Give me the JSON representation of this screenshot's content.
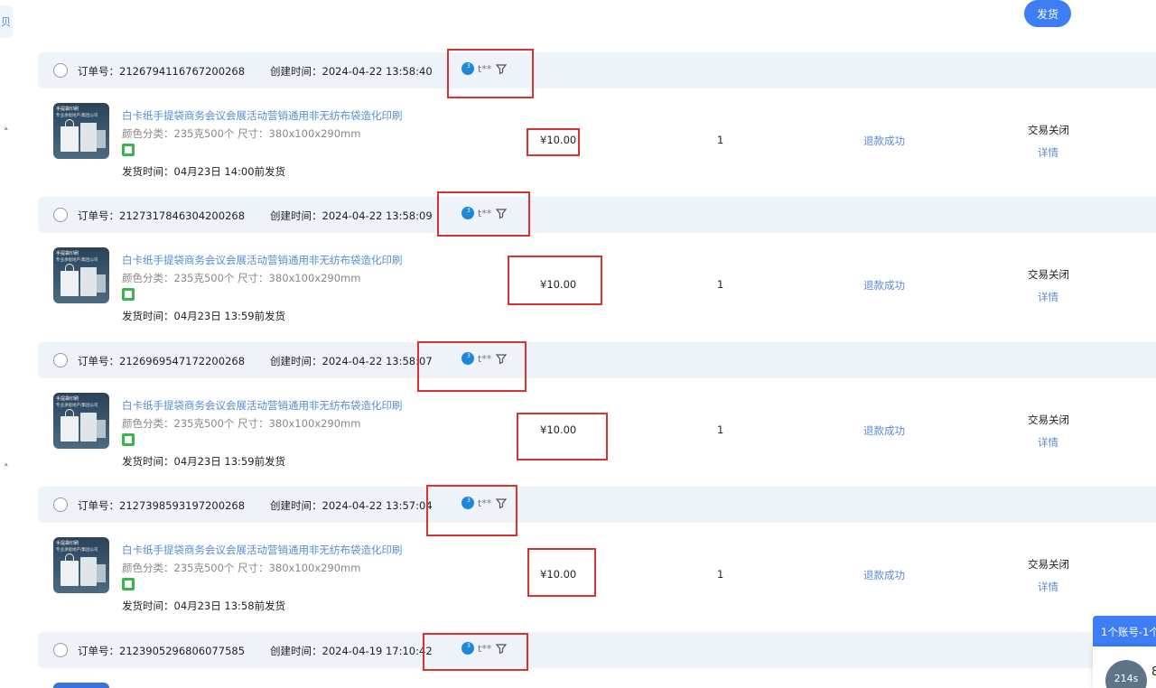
{
  "top": {
    "left_tab_label": "贝",
    "ship_button_label": "发货"
  },
  "orders": [
    {
      "order_no": "订单号：2126794116767200268",
      "created": "创建时间：2024-04-22 13:58:40",
      "buyer": "t**",
      "title": "白卡纸手提袋商务会议会展活动营销通用非无纺布袋造化印刷",
      "spec": "颜色分类：235克500个  尺寸：380x100x290mm",
      "ship_time": "发货时间：04月23日 14:00前发货",
      "price": "¥10.00",
      "qty": "1",
      "refund": "退款成功",
      "status": "交易关闭",
      "detail": "详情"
    },
    {
      "order_no": "订单号：2127317846304200268",
      "created": "创建时间：2024-04-22 13:58:09",
      "buyer": "t**",
      "title": "白卡纸手提袋商务会议会展活动营销通用非无纺布袋造化印刷",
      "spec": "颜色分类：235克500个  尺寸：380x100x290mm",
      "ship_time": "发货时间：04月23日 13:59前发货",
      "price": "¥10.00",
      "qty": "1",
      "refund": "退款成功",
      "status": "交易关闭",
      "detail": "详情"
    },
    {
      "order_no": "订单号：2126969547172200268",
      "created": "创建时间：2024-04-22 13:58:07",
      "buyer": "t**",
      "title": "白卡纸手提袋商务会议会展活动营销通用非无纺布袋造化印刷",
      "spec": "颜色分类：235克500个  尺寸：380x100x290mm",
      "ship_time": "发货时间：04月23日 13:59前发货",
      "price": "¥10.00",
      "qty": "1",
      "refund": "退款成功",
      "status": "交易关闭",
      "detail": "详情"
    },
    {
      "order_no": "订单号：2127398593197200268",
      "created": "创建时间：2024-04-22 13:57:04",
      "buyer": "t**",
      "title": "白卡纸手提袋商务会议会展活动营销通用非无纺布袋造化印刷",
      "spec": "颜色分类：235克500个  尺寸：380x100x290mm",
      "ship_time": "发货时间：04月23日 13:58前发货",
      "price": "¥10.00",
      "qty": "1",
      "refund": "退款成功",
      "status": "交易关闭",
      "detail": "详情"
    },
    {
      "order_no": "订单号：2123905296806077585",
      "created": "创建时间：2024-04-19 17:10:42",
      "buyer": "t**"
    }
  ],
  "thumbnail": {
    "line1": "手提袋印刷",
    "line2": "专业承接地产/集团公司"
  },
  "float": {
    "header": "1个账号-1个",
    "avatar_text": "214s",
    "side_text": "8"
  },
  "colors": {
    "accent": "#3d7ef5",
    "link": "#5b8ad6",
    "header_bg": "#eef2f9",
    "highlight_box": "#d9332f"
  }
}
